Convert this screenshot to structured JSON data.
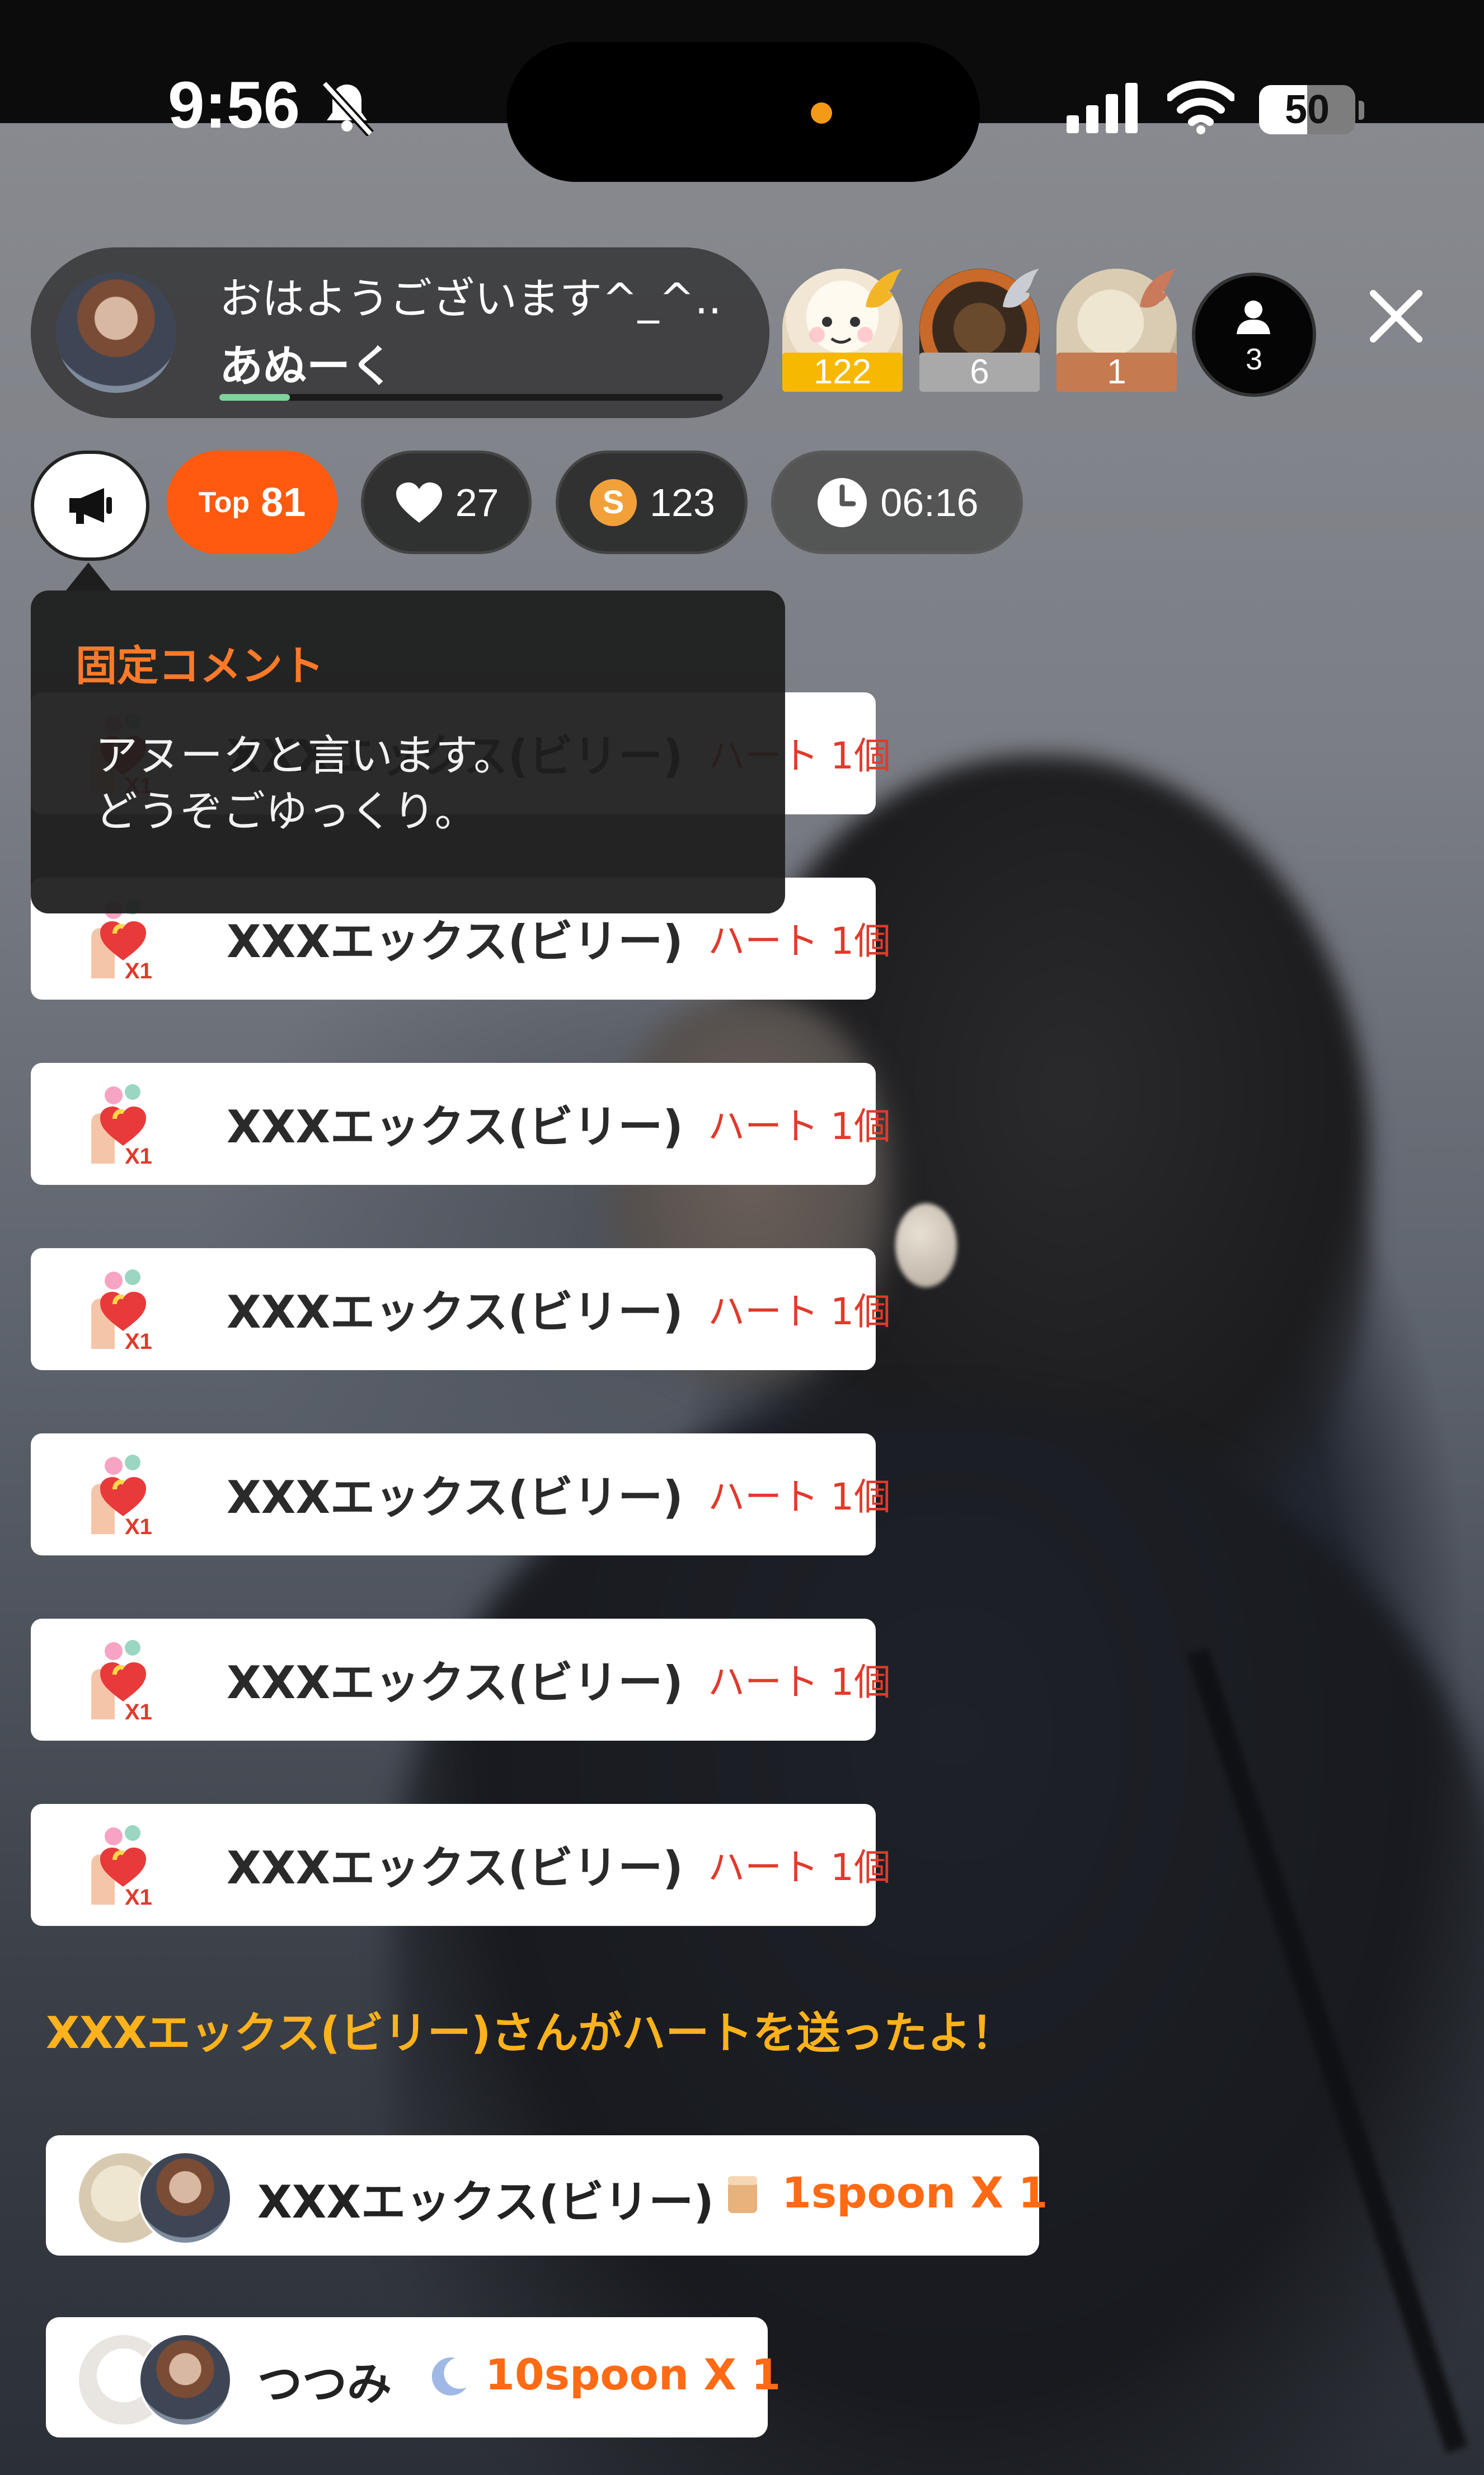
{
  "status_bar": {
    "time": "9:56",
    "battery": "50",
    "battery_level": 0.5
  },
  "host": {
    "title": "おはようございます^_^...",
    "name": "あぬーく",
    "progress": 0.14
  },
  "ranking": [
    {
      "count": "122",
      "badge_color": "#f6b800"
    },
    {
      "count": "6",
      "badge_color": "#a9a9a9"
    },
    {
      "count": "1",
      "badge_color": "#c57a50"
    }
  ],
  "listeners": {
    "count": "3"
  },
  "stats": {
    "top_label": "Top",
    "top_value": "81",
    "hearts": "27",
    "coins": "123",
    "coin_symbol": "S",
    "elapsed": "06:16"
  },
  "pinned": {
    "title": "固定コメント",
    "text": "アヌークと言います。\nどうぞごゆっくり。"
  },
  "gift_rows": [
    {
      "name": "XXXエックス(ビリー)",
      "item": "ハート 1個",
      "multiplier": "X1"
    },
    {
      "name": "XXXエックス(ビリー)",
      "item": "ハート 1個",
      "multiplier": "X1"
    },
    {
      "name": "XXXエックス(ビリー)",
      "item": "ハート 1個",
      "multiplier": "X1"
    },
    {
      "name": "XXXエックス(ビリー)",
      "item": "ハート 1個",
      "multiplier": "X1"
    },
    {
      "name": "XXXエックス(ビリー)",
      "item": "ハート 1個",
      "multiplier": "X1"
    },
    {
      "name": "XXXエックス(ビリー)",
      "item": "ハート 1個",
      "multiplier": "X1"
    },
    {
      "name": "XXXエックス(ビリー)",
      "item": "ハート 1個",
      "multiplier": "X1"
    }
  ],
  "system_message": "XXXエックス(ビリー)さんがハートを送ったよ！",
  "spoon_rows": [
    {
      "name": "XXXエックス(ビリー)",
      "amount": "1spoon X 1",
      "icon": "cup-icon"
    },
    {
      "name": "つつみ",
      "amount": "10spoon X 1",
      "icon": "moon-icon"
    }
  ],
  "colors": {
    "accent": "#ff5a0f",
    "gift_text": "#e03a2c",
    "system_text": "#ffb21c",
    "pinned_title": "#ff7a28"
  }
}
